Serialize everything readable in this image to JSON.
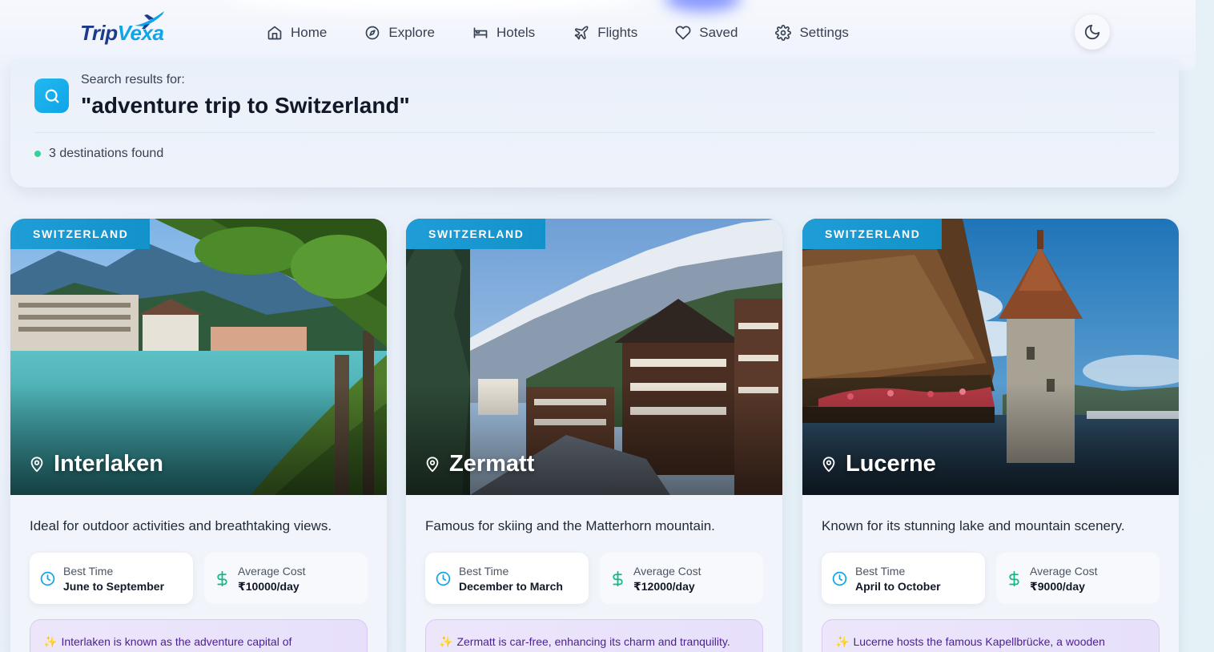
{
  "header": {
    "logo": {
      "part1": "Trip",
      "part2": "Vexa"
    },
    "nav": [
      {
        "label": "Home",
        "icon": "home-icon"
      },
      {
        "label": "Explore",
        "icon": "compass-icon"
      },
      {
        "label": "Hotels",
        "icon": "bed-icon"
      },
      {
        "label": "Flights",
        "icon": "plane-icon"
      },
      {
        "label": "Saved",
        "icon": "heart-icon"
      },
      {
        "label": "Settings",
        "icon": "gear-icon"
      }
    ],
    "theme_toggle_icon": "moon-icon"
  },
  "search": {
    "label": "Search results for:",
    "query": "\"adventure trip to Switzerland\"",
    "results_count": "3 destinations found"
  },
  "labels": {
    "best_time": "Best Time",
    "average_cost": "Average Cost"
  },
  "destinations": [
    {
      "country": "SWITZERLAND",
      "name": "Interlaken",
      "description": "Ideal for outdoor activities and breathtaking views.",
      "best_time": "June to September",
      "average_cost": "₹10000/day",
      "fact": "Interlaken is known as the adventure capital of"
    },
    {
      "country": "SWITZERLAND",
      "name": "Zermatt",
      "description": "Famous for skiing and the Matterhorn mountain.",
      "best_time": "December to March",
      "average_cost": "₹12000/day",
      "fact": "Zermatt is car-free, enhancing its charm and tranquility."
    },
    {
      "country": "SWITZERLAND",
      "name": "Lucerne",
      "description": "Known for its stunning lake and mountain scenery.",
      "best_time": "April to October",
      "average_cost": "₹9000/day",
      "fact": "Lucerne hosts the famous Kapellbrücke, a wooden"
    }
  ],
  "colors": {
    "accent": "#0ea5e9",
    "badge": "#1f9dd7",
    "brand_dark": "#1e3a8a",
    "fact_bg": "#ede6fb",
    "fact_text": "#4c1d95",
    "results_dot": "#34d399"
  }
}
